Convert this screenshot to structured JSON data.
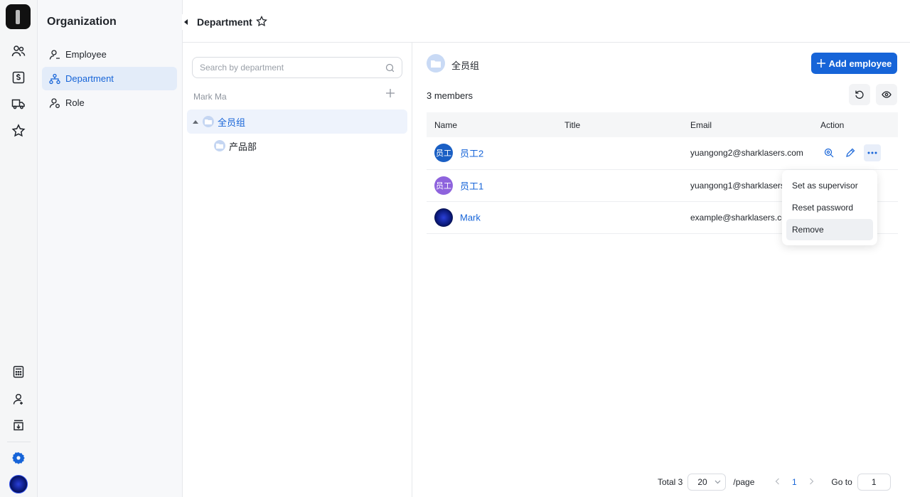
{
  "rail": {
    "icons": [
      "users-icon",
      "wallet-icon",
      "truck-icon",
      "star-icon",
      "calculator-icon",
      "person-icon",
      "inbox-icon",
      "settings-icon"
    ]
  },
  "org": {
    "title": "Organization",
    "items": [
      {
        "label": "Employee",
        "icon": "user-icon"
      },
      {
        "label": "Department",
        "icon": "org-tree-icon",
        "active": true
      },
      {
        "label": "Role",
        "icon": "role-icon"
      }
    ]
  },
  "header": {
    "title": "Department"
  },
  "tree": {
    "search_placeholder": "Search by department",
    "owner": "Mark Ma",
    "root": "全员组",
    "child": "产品部"
  },
  "main": {
    "group_name": "全员组",
    "add_button": "Add employee",
    "members": "3 members",
    "columns": [
      "Name",
      "Title",
      "Email",
      "Action"
    ],
    "rows": [
      {
        "avatar": "员工",
        "name": "员工2",
        "title": "",
        "email": "yuangong2@sharklasers.com"
      },
      {
        "avatar": "员工",
        "name": "员工1",
        "title": "",
        "email": "yuangong1@sharklasers"
      },
      {
        "avatar": "",
        "name": "Mark",
        "title": "",
        "email": "example@sharklasers.co"
      }
    ]
  },
  "menu": {
    "items": [
      "Set as supervisor",
      "Reset password",
      "Remove"
    ]
  },
  "pager": {
    "total": "Total 3",
    "page_size": "20",
    "per_page": "/page",
    "current": "1",
    "goto_label": "Go to",
    "goto_value": "1"
  },
  "colors": {
    "accent": "#1664d8",
    "active_bg": "#e3ecf9"
  }
}
